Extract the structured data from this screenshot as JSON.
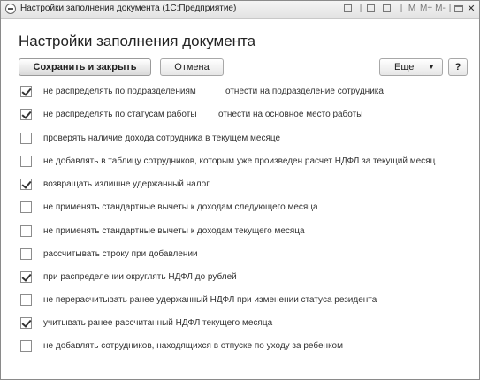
{
  "window": {
    "title": "Настройки заполнения документа  (1С:Предприятие)",
    "controls": {
      "m": "M",
      "m_plus": "M+",
      "m_minus": "M-"
    }
  },
  "form": {
    "heading": "Настройки заполнения документа",
    "toolbar": {
      "save_close_label": "Сохранить и закрыть",
      "cancel_label": "Отмена",
      "more_label": "Еще",
      "more_arrow": "▼",
      "help_label": "?"
    },
    "options": [
      {
        "label": "не распределять по подразделениям",
        "extra": "отнести на подразделение сотрудника",
        "checked": true
      },
      {
        "label": "не распределять по статусам работы",
        "extra": "отнести на основное место работы",
        "checked": true
      },
      {
        "label": "проверять наличие дохода сотрудника в текущем месяце",
        "checked": false
      },
      {
        "label": "не добавлять в таблицу сотрудников, которым уже произведен расчет НДФЛ за текущий месяц",
        "checked": false
      },
      {
        "label": "возвращать излишне удержанный налог",
        "checked": true
      },
      {
        "label": "не применять стандартные вычеты к доходам следующего месяца",
        "checked": false
      },
      {
        "label": "не применять стандартные вычеты к доходам текущего месяца",
        "checked": false
      },
      {
        "label": "рассчитывать строку при добавлении",
        "checked": false
      },
      {
        "label": "при распределении округлять НДФЛ до рублей",
        "checked": true
      },
      {
        "label": "не перерасчитывать ранее удержанный НДФЛ при изменении статуса резидента",
        "checked": false
      },
      {
        "label": "учитывать ранее рассчитанный НДФЛ текущего месяца",
        "checked": true
      },
      {
        "label": "не добавлять сотрудников, находящихся в отпуске по уходу за ребенком",
        "checked": false
      }
    ]
  }
}
